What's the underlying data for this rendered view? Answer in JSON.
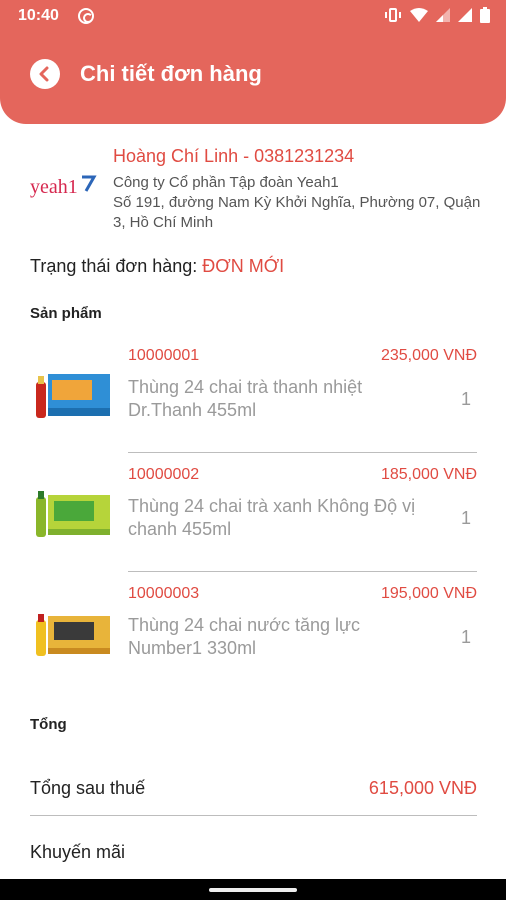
{
  "status_bar": {
    "time": "10:40"
  },
  "header": {
    "title": "Chi tiết đơn hàng"
  },
  "customer": {
    "logo_text": "yeah1",
    "name_phone": "Hoàng Chí Linh - 0381231234",
    "company": "Công ty Cổ phần Tập đoàn Yeah1",
    "address": "Số 191, đường Nam Kỳ Khởi Nghĩa, Phường 07, Quận 3, Hồ Chí Minh"
  },
  "order_status": {
    "label": "Trạng thái đơn hàng:",
    "value": "ĐƠN MỚI"
  },
  "products_label": "Sản phẩm",
  "products": [
    {
      "code": "10000001",
      "price": "235,000 VNĐ",
      "name": "Thùng 24 chai trà thanh nhiệt Dr.Thanh 455ml",
      "qty": "1"
    },
    {
      "code": "10000002",
      "price": "185,000 VNĐ",
      "name": "Thùng 24 chai trà xanh Không Độ vị chanh 455ml",
      "qty": "1"
    },
    {
      "code": "10000003",
      "price": "195,000 VNĐ",
      "name": "Thùng 24 chai nước tăng lực Number1 330ml",
      "qty": "1"
    }
  ],
  "totals_label": "Tổng",
  "totals": {
    "after_tax_label": "Tổng sau thuế",
    "after_tax_value": "615,000 VNĐ",
    "promo_label": "Khuyến mãi"
  },
  "colors": {
    "accent": "#e4665c",
    "price": "#e04b42",
    "muted": "#9a9a9a"
  }
}
